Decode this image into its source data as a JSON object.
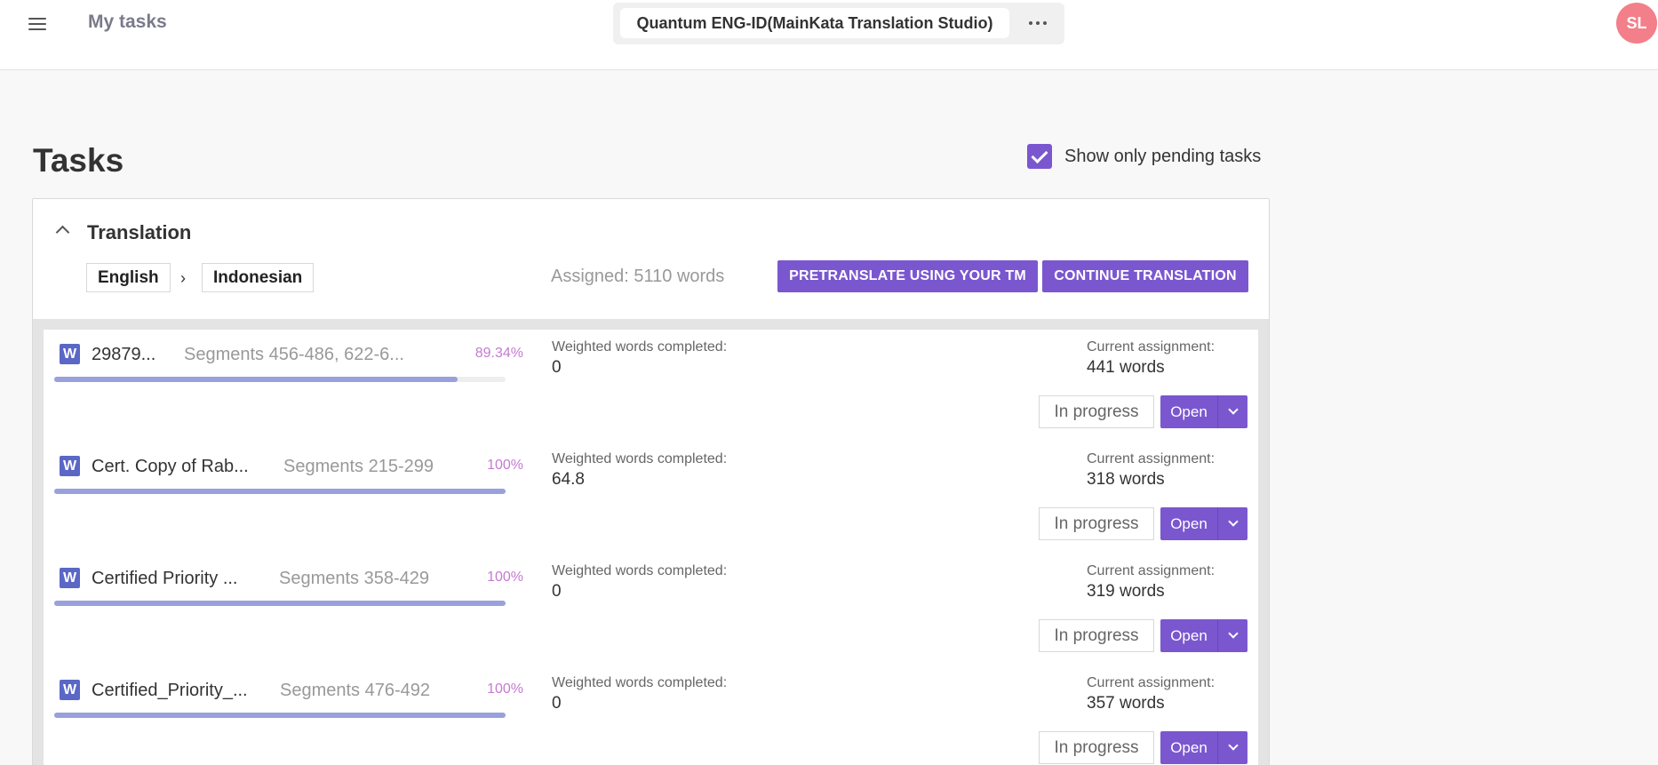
{
  "header": {
    "title": "My tasks",
    "project_name": "Quantum ENG-ID(MainKata Translation Studio)",
    "avatar_initials": "SL"
  },
  "tasks": {
    "title": "Tasks",
    "show_pending_label": "Show only pending tasks",
    "show_pending_checked": true
  },
  "section": {
    "title": "Translation",
    "source_lang": "English",
    "arrow": "›",
    "target_lang": "Indonesian",
    "assigned": "Assigned: 5110 words",
    "pretranslate_label": "PRETRANSLATE USING YOUR TM",
    "continue_label": "CONTINUE TRANSLATION"
  },
  "task_rows": [
    {
      "icon": "W",
      "name": "29879...",
      "segments": "Segments 456-486, 622-6...",
      "percent": "89.34%",
      "progress": 0.8934,
      "ww_label": "Weighted words completed:",
      "ww_value": "0",
      "ca_label": "Current assignment:",
      "ca_value": "441 words",
      "status": "In progress",
      "open_label": "Open"
    },
    {
      "icon": "W",
      "name": "Cert. Copy of Rab...",
      "segments": "Segments 215-299",
      "percent": "100%",
      "progress": 1.0,
      "ww_label": "Weighted words completed:",
      "ww_value": "64.8",
      "ca_label": "Current assignment:",
      "ca_value": "318 words",
      "status": "In progress",
      "open_label": "Open"
    },
    {
      "icon": "W",
      "name": "Certified Priority ...",
      "segments": "Segments 358-429",
      "percent": "100%",
      "progress": 1.0,
      "ww_label": "Weighted words completed:",
      "ww_value": "0",
      "ca_label": "Current assignment:",
      "ca_value": "319 words",
      "status": "In progress",
      "open_label": "Open"
    },
    {
      "icon": "W",
      "name": "Certified_Priority_...",
      "segments": "Segments 476-492",
      "percent": "100%",
      "progress": 1.0,
      "ww_label": "Weighted words completed:",
      "ww_value": "0",
      "ca_label": "Current assignment:",
      "ca_value": "357 words",
      "status": "In progress",
      "open_label": "Open"
    }
  ],
  "colors": {
    "accent": "#7a57cf",
    "progress": "#98a1dc",
    "percent": "#c47bd0",
    "word_icon": "#5a67c6",
    "avatar": "#f27f89"
  }
}
